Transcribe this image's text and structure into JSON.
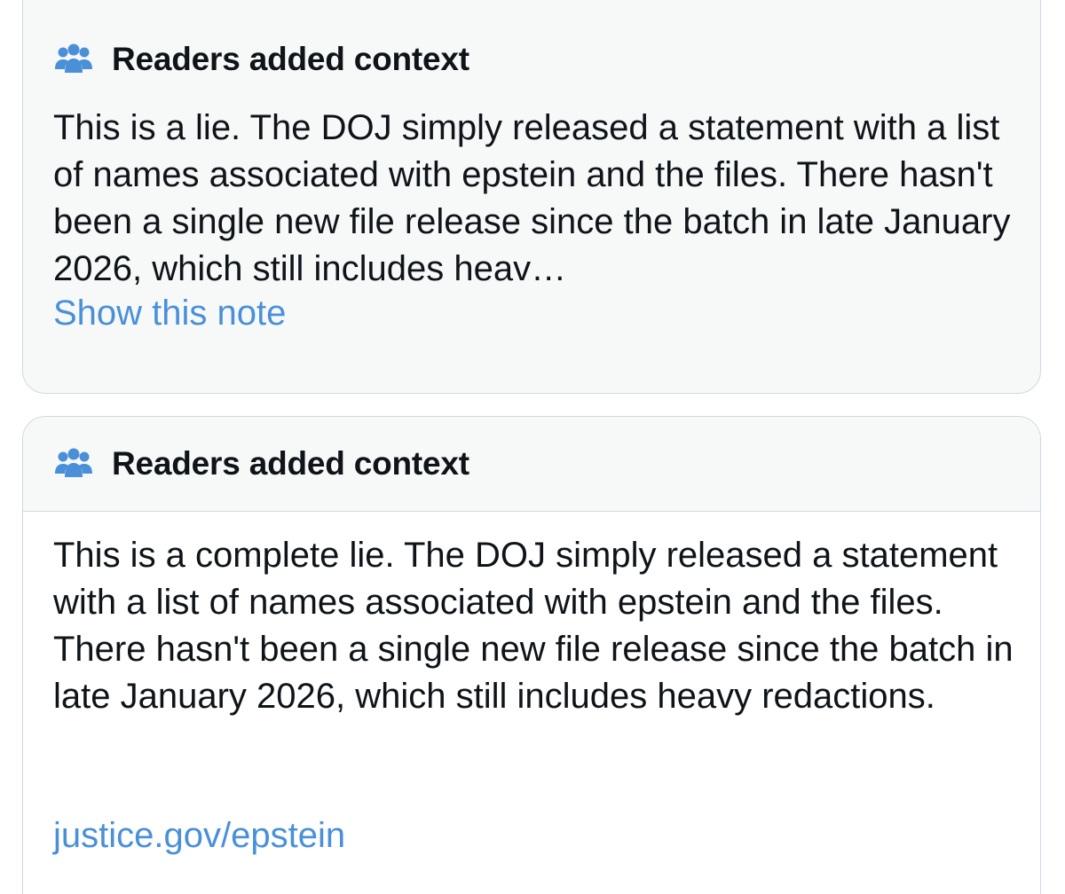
{
  "colors": {
    "icon_blue": "#4a90d9",
    "link_blue": "#4a90d9",
    "card_bg": "#f7f9f9",
    "border": "#cfd9de",
    "text": "#0f1419"
  },
  "notes": [
    {
      "icon": "readers-group-icon",
      "title": "Readers added context",
      "body": "This is a lie. The DOJ simply released a statement with a list of names associated with epstein and the files. There hasn't been a single new file release since the batch in late January 2026, which still includes heav…",
      "action_label": "Show this note"
    },
    {
      "icon": "readers-group-icon",
      "title": "Readers added context",
      "body": "This is a complete lie. The DOJ simply released a statement with a list of names associated with epstein and the files. There hasn't been a single new file release since the batch in late January 2026, which still includes heavy redactions.",
      "link": "justice.gov/epstein"
    }
  ]
}
